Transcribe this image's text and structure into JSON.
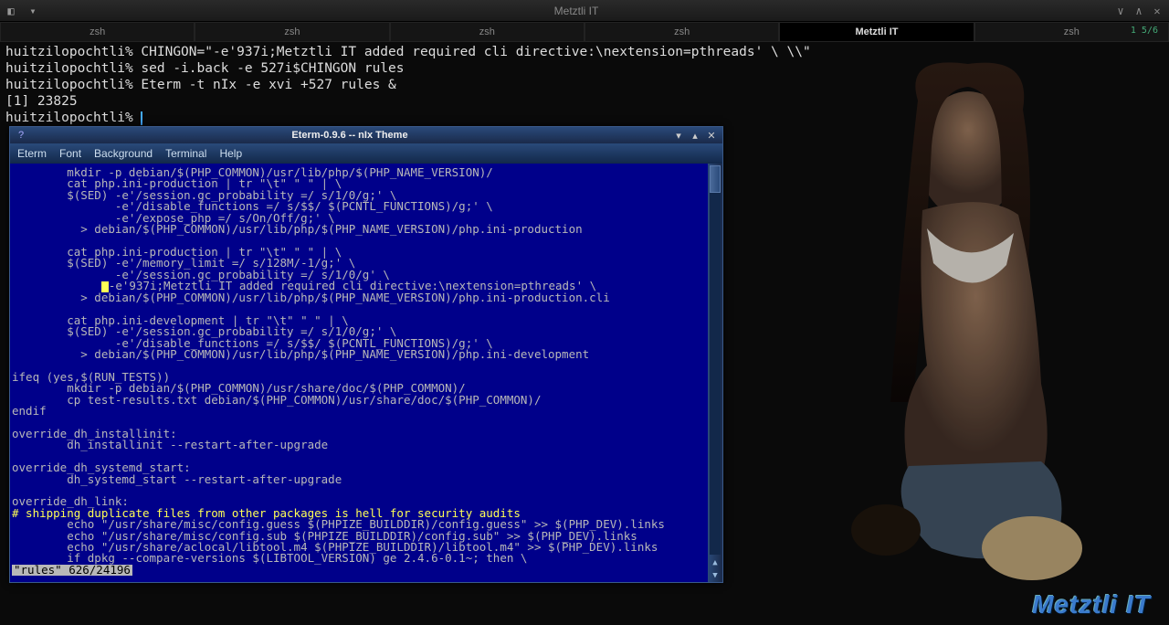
{
  "window": {
    "title": "Metztli IT",
    "indicator": "1  5/6"
  },
  "tabs": [
    {
      "label": "zsh"
    },
    {
      "label": "zsh"
    },
    {
      "label": "zsh"
    },
    {
      "label": "zsh"
    },
    {
      "label": "Metztli IT",
      "active": true
    },
    {
      "label": "zsh"
    }
  ],
  "terminal_lines": [
    "huitzilopochtli% CHINGON=\"-e'937i;Metztli IT added required cli directive:\\nextension=pthreads' \\ \\\\\"",
    "huitzilopochtli% sed -i.back -e 527i$CHINGON rules",
    "huitzilopochtli% Eterm -t nIx -e xvi +527 rules &",
    "[1] 23825",
    "huitzilopochtli% "
  ],
  "eterm": {
    "title": "Eterm-0.9.6 -- nIx Theme",
    "menus": [
      "Eterm",
      "Font",
      "Background",
      "Terminal",
      "Help"
    ],
    "body": "        mkdir -p debian/$(PHP_COMMON)/usr/lib/php/$(PHP_NAME_VERSION)/\n        cat php.ini-production | tr \"\\t\" \" \" | \\\n        $(SED) -e'/session.gc_probability =/ s/1/0/g;' \\\n               -e'/disable_functions =/ s/$$/ $(PCNTL_FUNCTIONS)/g;' \\\n               -e'/expose_php =/ s/On/Off/g;' \\\n          > debian/$(PHP_COMMON)/usr/lib/php/$(PHP_NAME_VERSION)/php.ini-production\n\n        cat php.ini-production | tr \"\\t\" \" \" | \\\n        $(SED) -e'/memory_limit =/ s/128M/-1/g;' \\\n               -e'/session.gc_probability =/ s/1/0/g' \\\n",
    "hl_line_after_cursor": "-e'937i;Metztli IT added required cli directive:\\nextension=pthreads' \\",
    "body2": "          > debian/$(PHP_COMMON)/usr/lib/php/$(PHP_NAME_VERSION)/php.ini-production.cli\n\n        cat php.ini-development | tr \"\\t\" \" \" | \\\n        $(SED) -e'/session.gc_probability =/ s/1/0/g;' \\\n               -e'/disable_functions =/ s/$$/ $(PCNTL_FUNCTIONS)/g;' \\\n          > debian/$(PHP_COMMON)/usr/lib/php/$(PHP_NAME_VERSION)/php.ini-development\n\nifeq (yes,$(RUN_TESTS))\n        mkdir -p debian/$(PHP_COMMON)/usr/share/doc/$(PHP_COMMON)/\n        cp test-results.txt debian/$(PHP_COMMON)/usr/share/doc/$(PHP_COMMON)/\nendif\n\noverride_dh_installinit:\n        dh_installinit --restart-after-upgrade\n\noverride_dh_systemd_start:\n        dh_systemd_start --restart-after-upgrade\n\noverride_dh_link:\n",
    "comment": "# shipping duplicate files from other packages is hell for security audits",
    "body3": "        echo \"/usr/share/misc/config.guess $(PHPIZE_BUILDDIR)/config.guess\" >> $(PHP_DEV).links\n        echo \"/usr/share/misc/config.sub $(PHPIZE_BUILDDIR)/config.sub\" >> $(PHP_DEV).links\n        echo \"/usr/share/aclocal/libtool.m4 $(PHPIZE_BUILDDIR)/libtool.m4\" >> $(PHP_DEV).links\n        if dpkg --compare-versions $(LIBTOOL_VERSION) ge 2.4.6-0.1~; then \\",
    "status": "\"rules\" 626/24196"
  },
  "watermark": "Metztli IT"
}
